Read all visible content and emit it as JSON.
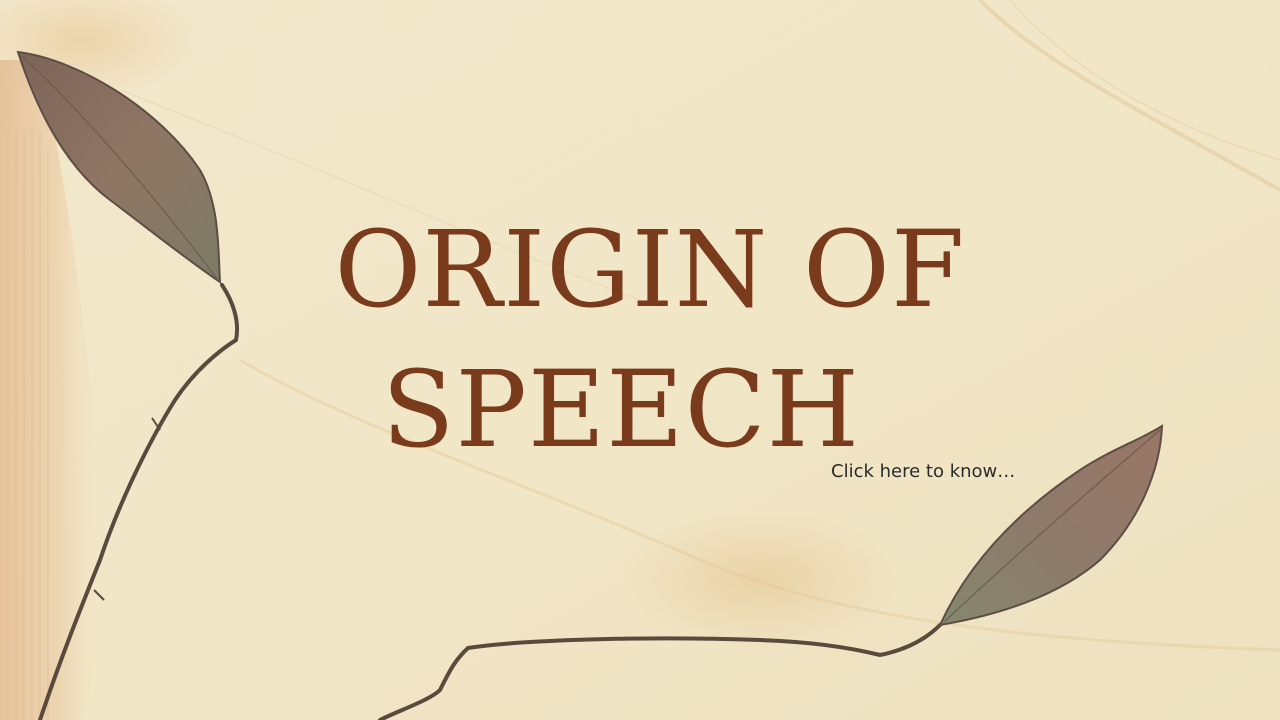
{
  "slide": {
    "title_line1": "ORIGIN OF",
    "title_line2": "SPEECH",
    "link_text": "Click here to know…",
    "colors": {
      "title": "#7a3a1c",
      "background": "#efe4c6",
      "link": "#2b2b2b",
      "leaf": "#8c7463",
      "branch": "#5a4a3e"
    },
    "icons": [
      "leaf-icon",
      "branch-icon"
    ]
  }
}
